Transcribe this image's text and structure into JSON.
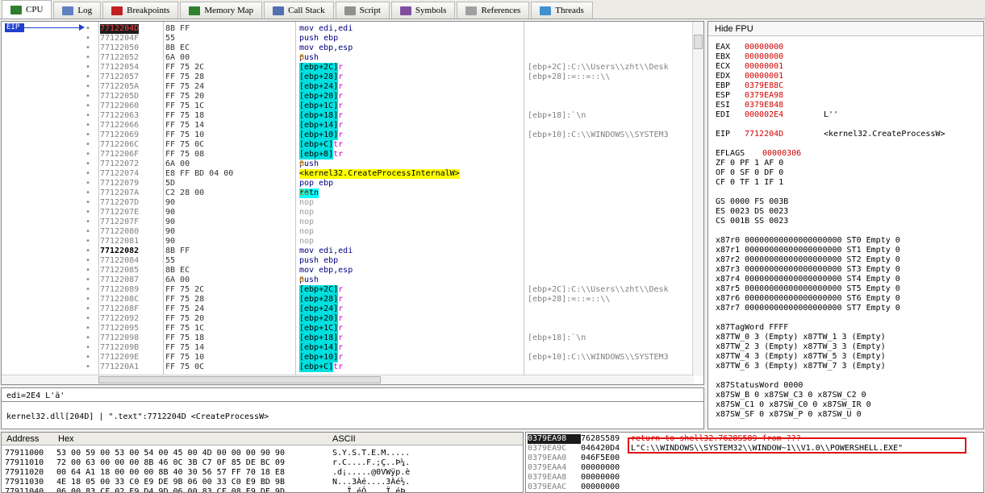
{
  "tabs": [
    {
      "label": "CPU",
      "icon": "cpu-icon",
      "color": "#2f7d2f"
    },
    {
      "label": "Log",
      "icon": "log-icon",
      "color": "#6080c0"
    },
    {
      "label": "Breakpoints",
      "icon": "breakpoint-icon",
      "color": "#c02020"
    },
    {
      "label": "Memory Map",
      "icon": "memory-map-icon",
      "color": "#308030"
    },
    {
      "label": "Call Stack",
      "icon": "call-stack-icon",
      "color": "#5070b0"
    },
    {
      "label": "Script",
      "icon": "script-icon",
      "color": "#909090"
    },
    {
      "label": "Symbols",
      "icon": "symbols-icon",
      "color": "#8050a0"
    },
    {
      "label": "References",
      "icon": "references-icon",
      "color": "#a0a0a0"
    },
    {
      "label": "Threads",
      "icon": "threads-icon",
      "color": "#4090d0"
    }
  ],
  "eip_label": "EIP",
  "disasm": [
    {
      "addr": "7712204D",
      "bytes": "8B FF",
      "ins": "mov edi,edi",
      "cmt": "",
      "sel": true
    },
    {
      "addr": "7712204F",
      "bytes": "55",
      "ins": "push ebp",
      "cmt": ""
    },
    {
      "addr": "77122050",
      "bytes": "8B EC",
      "ins": "mov ebp,esp",
      "cmt": ""
    },
    {
      "addr": "77122052",
      "bytes": "6A 00",
      "ins": "push 0",
      "cmt": ""
    },
    {
      "addr": "77122054",
      "bytes": "FF 75 2C",
      "ins": "push dword ptr ss:[ebp+2C]",
      "cmt": "[ebp+2C]:C:\\\\Users\\\\zht\\\\Desk"
    },
    {
      "addr": "77122057",
      "bytes": "FF 75 28",
      "ins": "push dword ptr ss:[ebp+28]",
      "cmt": "[ebp+28]:=::=::\\\\"
    },
    {
      "addr": "7712205A",
      "bytes": "FF 75 24",
      "ins": "push dword ptr ss:[ebp+24]",
      "cmt": ""
    },
    {
      "addr": "7712205D",
      "bytes": "FF 75 20",
      "ins": "push dword ptr ss:[ebp+20]",
      "cmt": ""
    },
    {
      "addr": "77122060",
      "bytes": "FF 75 1C",
      "ins": "push dword ptr ss:[ebp+1C]",
      "cmt": ""
    },
    {
      "addr": "77122063",
      "bytes": "FF 75 18",
      "ins": "push dword ptr ss:[ebp+18]",
      "cmt": "[ebp+18]:`\\n"
    },
    {
      "addr": "77122066",
      "bytes": "FF 75 14",
      "ins": "push dword ptr ss:[ebp+14]",
      "cmt": ""
    },
    {
      "addr": "77122069",
      "bytes": "FF 75 10",
      "ins": "push dword ptr ss:[ebp+10]",
      "cmt": "[ebp+10]:C:\\\\WINDOWS\\\\SYSTEM3"
    },
    {
      "addr": "7712206C",
      "bytes": "FF 75 0C",
      "ins": "push dword ptr ss:[ebp+C]",
      "cmt": ""
    },
    {
      "addr": "7712206F",
      "bytes": "FF 75 08",
      "ins": "push dword ptr ss:[ebp+8]",
      "cmt": ""
    },
    {
      "addr": "77122072",
      "bytes": "6A 00",
      "ins": "push 0",
      "cmt": ""
    },
    {
      "addr": "77122074",
      "bytes": "E8 FF BD 04 00",
      "ins": "call <kernel32.CreateProcessInternalW>",
      "cmt": ""
    },
    {
      "addr": "77122079",
      "bytes": "5D",
      "ins": "pop ebp",
      "cmt": ""
    },
    {
      "addr": "7712207A",
      "bytes": "C2 28 00",
      "ins": "retn 28",
      "cmt": ""
    },
    {
      "addr": "7712207D",
      "bytes": "90",
      "ins": "nop",
      "cmt": ""
    },
    {
      "addr": "7712207E",
      "bytes": "90",
      "ins": "nop",
      "cmt": ""
    },
    {
      "addr": "7712207F",
      "bytes": "90",
      "ins": "nop",
      "cmt": ""
    },
    {
      "addr": "77122080",
      "bytes": "90",
      "ins": "nop",
      "cmt": ""
    },
    {
      "addr": "77122081",
      "bytes": "90",
      "ins": "nop",
      "cmt": ""
    },
    {
      "addr": "77122082",
      "bytes": "8B FF",
      "ins": "mov edi,edi",
      "cmt": "",
      "hl": true
    },
    {
      "addr": "77122084",
      "bytes": "55",
      "ins": "push ebp",
      "cmt": ""
    },
    {
      "addr": "77122085",
      "bytes": "8B EC",
      "ins": "mov ebp,esp",
      "cmt": ""
    },
    {
      "addr": "77122087",
      "bytes": "6A 00",
      "ins": "push 0",
      "cmt": ""
    },
    {
      "addr": "77122089",
      "bytes": "FF 75 2C",
      "ins": "push dword ptr ss:[ebp+2C]",
      "cmt": "[ebp+2C]:C:\\\\Users\\\\zht\\\\Desk"
    },
    {
      "addr": "7712208C",
      "bytes": "FF 75 28",
      "ins": "push dword ptr ss:[ebp+28]",
      "cmt": "[ebp+28]:=::=::\\\\"
    },
    {
      "addr": "7712208F",
      "bytes": "FF 75 24",
      "ins": "push dword ptr ss:[ebp+24]",
      "cmt": ""
    },
    {
      "addr": "77122092",
      "bytes": "FF 75 20",
      "ins": "push dword ptr ss:[ebp+20]",
      "cmt": ""
    },
    {
      "addr": "77122095",
      "bytes": "FF 75 1C",
      "ins": "push dword ptr ss:[ebp+1C]",
      "cmt": ""
    },
    {
      "addr": "77122098",
      "bytes": "FF 75 18",
      "ins": "push dword ptr ss:[ebp+18]",
      "cmt": "[ebp+18]:`\\n"
    },
    {
      "addr": "7712209B",
      "bytes": "FF 75 14",
      "ins": "push dword ptr ss:[ebp+14]",
      "cmt": ""
    },
    {
      "addr": "7712209E",
      "bytes": "FF 75 10",
      "ins": "push dword ptr ss:[ebp+10]",
      "cmt": "[ebp+10]:C:\\\\WINDOWS\\\\SYSTEM3"
    },
    {
      "addr": "771220A1",
      "bytes": "FF 75 0C",
      "ins": "push dword ptr ss:[ebp+C]",
      "cmt": ""
    }
  ],
  "info_line1": "edi=2E4 L'ä'",
  "info_line2": "kernel32.dll[204D] | \".text\":7712204D <CreateProcessW>",
  "fpu": {
    "header": "Hide FPU",
    "regs": [
      {
        "name": "EAX",
        "val": "00000000",
        "extra": ""
      },
      {
        "name": "EBX",
        "val": "00000000",
        "extra": ""
      },
      {
        "name": "ECX",
        "val": "00000001",
        "extra": ""
      },
      {
        "name": "EDX",
        "val": "00000001",
        "extra": ""
      },
      {
        "name": "EBP",
        "val": "0379E88C",
        "extra": ""
      },
      {
        "name": "ESP",
        "val": "0379EA98",
        "extra": ""
      },
      {
        "name": "ESI",
        "val": "0379E848",
        "extra": ""
      },
      {
        "name": "EDI",
        "val": "000002E4",
        "extra": "L''"
      }
    ],
    "eip": {
      "name": "EIP",
      "val": "7712204D",
      "extra": "<kernel32.CreateProcessW>"
    },
    "eflags": {
      "name": "EFLAGS",
      "val": "00000306"
    },
    "flags": [
      "ZF 0  PF 1  AF 0",
      "OF 0  SF 0  DF 0",
      "CF 0  TF 1  IF 1"
    ],
    "segs": [
      "GS 0000  FS 003B",
      "ES 0023  DS 0023",
      "CS 001B  SS 0023"
    ],
    "x87": [
      "x87r0 00000000000000000000 ST0 Empty 0",
      "x87r1 00000000000000000000 ST1 Empty 0",
      "x87r2 00000000000000000000 ST2 Empty 0",
      "x87r3 00000000000000000000 ST3 Empty 0",
      "x87r4 00000000000000000000 ST4 Empty 0",
      "x87r5 00000000000000000000 ST5 Empty 0",
      "x87r6 00000000000000000000 ST6 Empty 0",
      "x87r7 00000000000000000000 ST7 Empty 0"
    ],
    "tag": [
      "x87TagWord FFFF",
      "x87TW_0 3 (Empty)    x87TW_1 3 (Empty)",
      "x87TW_2 3 (Empty)    x87TW_3 3 (Empty)",
      "x87TW_4 3 (Empty)    x87TW_5 3 (Empty)",
      "x87TW_6 3 (Empty)    x87TW_7 3 (Empty)"
    ],
    "status": [
      "x87StatusWord 0000",
      "x87SW_B  0  x87SW_C3  0  x87SW_C2  0",
      "x87SW_C1 0  x87SW_C0  0  x87SW_IR  0",
      "x87SW_SF 0  x87SW_P   0  x87SW_U   0"
    ]
  },
  "dump": {
    "headers": {
      "address": "Address",
      "hex": "Hex",
      "ascii": "ASCII"
    },
    "rows": [
      {
        "addr": "77911000",
        "hex": "53 00 59 00 53 00 54 00 45 00 4D 00 00 00 90 90",
        "ascii": "S.Y.S.T.E.M....."
      },
      {
        "addr": "77911010",
        "hex": "72 00 63 00 00 00 8B 46 0C 3B C7 0F 85 DE BC 09",
        "ascii": "r.C....F.;Ç..Þ¼."
      },
      {
        "addr": "77911020",
        "hex": "00 64 A1 18 00 00 00 8B 40 30 56 57 FF 70 18 E8",
        "ascii": ".d¡.....@0VWÿp.è"
      },
      {
        "addr": "77911030",
        "hex": "4E 18 05 00 33 C0 E9 DE 9B 06 00 33 C0 E9 BD 9B",
        "ascii": "N...3Àé....3Àé½."
      },
      {
        "addr": "77911040",
        "hex": "06 00 83 CF 02 E9 D4 9D 06 00 83 CF 08 E9 DE 9D",
        "ascii": "...Ï.éÔ....Ï.éÞ."
      }
    ]
  },
  "stack": [
    {
      "addr": "0379EA98",
      "val": "7628S589",
      "cmt": "return to shell32.7628S589 from ???",
      "sel": true
    },
    {
      "addr": "0379EA9C",
      "val": "046420D4",
      "cmt": "L\"C:\\\\WINDOWS\\\\SYSTEM32\\\\WINDOW~1\\\\V1.0\\\\POWERSHELL.EXE\""
    },
    {
      "addr": "0379EAA0",
      "val": "046F5E00",
      "cmt": ""
    },
    {
      "addr": "0379EAA4",
      "val": "00000000",
      "cmt": ""
    },
    {
      "addr": "0379EAA8",
      "val": "00000000",
      "cmt": ""
    },
    {
      "addr": "0379EAAC",
      "val": "00000000",
      "cmt": ""
    }
  ],
  "colors": {
    "accent_eip": "#2040d0",
    "highlight_call": "#ffff00",
    "highlight_ret": "#00ffff",
    "reg_changed": "#d00000",
    "annot_box": "#e01010"
  }
}
